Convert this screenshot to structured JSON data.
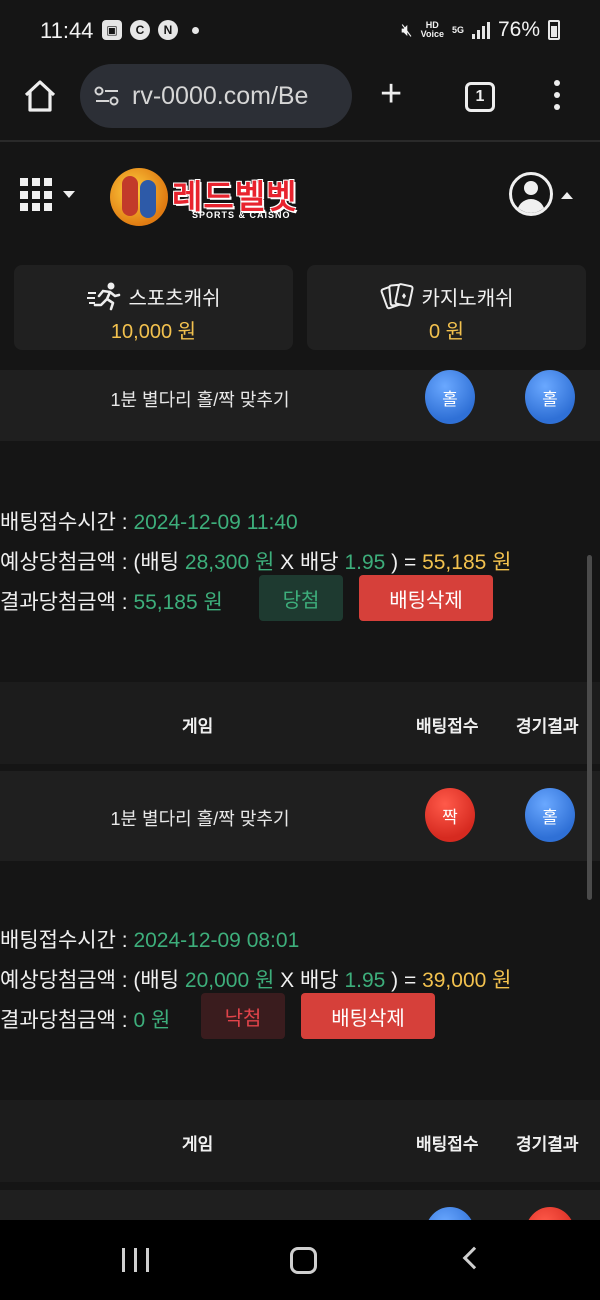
{
  "status_bar": {
    "time": "11:44",
    "battery": "76%",
    "hd_label": "HD\nVoice",
    "net_label": "5G"
  },
  "browser": {
    "url": "rv-0000.com/Be",
    "tab_count": "1"
  },
  "site": {
    "logo_title": "레드벨벳",
    "logo_subtitle": "SPORTS & CAISNO"
  },
  "cash": {
    "sports_label": "스포츠캐쉬",
    "sports_value": "10,000 원",
    "casino_label": "카지노캐쉬",
    "casino_value": "0 원"
  },
  "bets": [
    {
      "game": "1분 별다리 홀/짝 맞추기",
      "bet_pick": "홀",
      "result": "홀",
      "time_label": "배팅접수시간 : ",
      "time_value": "2024-12-09 11:40",
      "expected_label": "예상당첨금액 : (배팅 ",
      "bet_amount": "28,300 원",
      "x_odds_label": " X 배당 ",
      "odds": "1.95",
      "eq_label": " ) = ",
      "expected_value": "55,185 원",
      "result_label": "결과당첨금액 : ",
      "result_value": "55,185 원",
      "status": "당첨",
      "delete_label": "배팅삭제"
    },
    {
      "game": "1분 별다리 홀/짝 맞추기",
      "bet_pick": "짝",
      "result": "홀",
      "time_label": "배팅접수시간 : ",
      "time_value": "2024-12-09 08:01",
      "expected_label": "예상당첨금액 : (배팅 ",
      "bet_amount": "20,000 원",
      "x_odds_label": " X 배당 ",
      "odds": "1.95",
      "eq_label": " ) = ",
      "expected_value": "39,000 원",
      "result_label": "결과당첨금액 : ",
      "result_value": "0 원",
      "status": "낙첨",
      "delete_label": "배팅삭제"
    }
  ],
  "table_header": {
    "game": "게임",
    "bet": "배팅접수",
    "result": "경기결과"
  },
  "colors": {
    "accent_green": "#3dae7b",
    "accent_gold": "#f2c14e",
    "delete_red": "#d6403a",
    "ball_blue": "#2f70d6",
    "ball_red": "#d62a20"
  }
}
